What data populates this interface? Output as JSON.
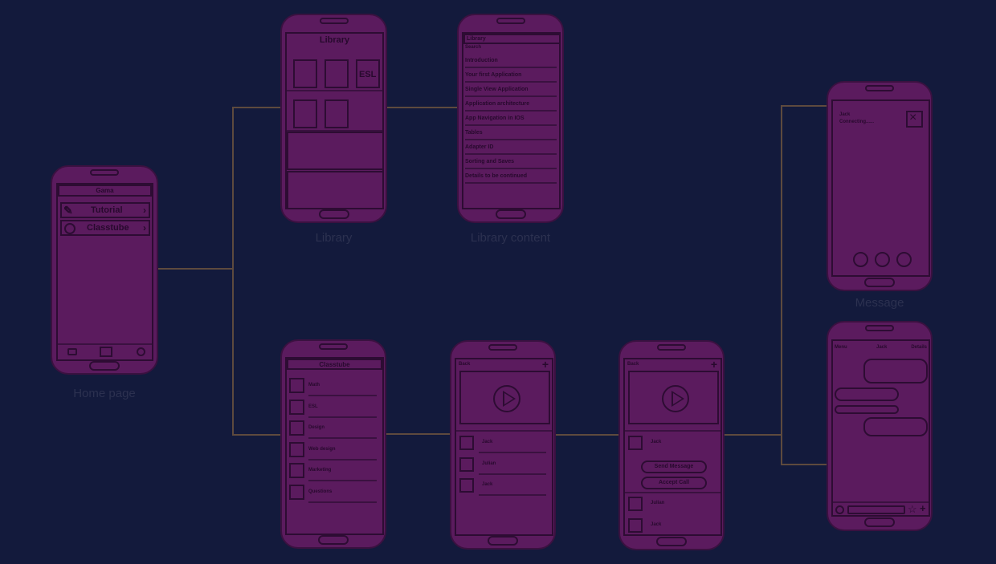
{
  "labels": {
    "home": "Home page",
    "library": "Library",
    "library_content": "Library content",
    "message": "Message"
  },
  "home": {
    "header": "Gama",
    "items": [
      "Tutorial",
      "Classtube"
    ]
  },
  "library": {
    "title": "Library",
    "tiles": [
      "",
      "",
      "ESL",
      "",
      ""
    ]
  },
  "library_content": {
    "header": "Library",
    "sub": "Search",
    "items": [
      "Introduction",
      "Your first Application",
      "Single View Application",
      "Application architecture",
      "App Navigation in IOS",
      "Tables",
      "Adapter ID",
      "Sorting and Saves",
      "Details to be continued"
    ]
  },
  "classtube": {
    "header": "Classtube",
    "items": [
      "Math",
      "ESL",
      "Design",
      "Web design",
      "Marketing",
      "Questions"
    ]
  },
  "video1": {
    "back": "Back",
    "people": [
      "Jack",
      "Julian",
      "Jack"
    ]
  },
  "video2": {
    "back": "Back",
    "person": "Jack",
    "buttons": [
      "Send Message",
      "Accept Call"
    ],
    "people": [
      "Julian",
      "Jack"
    ]
  },
  "message": {
    "caller": "Jack",
    "status": "Connecting......"
  },
  "chat": {
    "left": "Menu",
    "center": "Jack",
    "right": "Details"
  },
  "colors": {
    "background": "#131a3c",
    "phone": "#5b1b5e",
    "outline": "#2d0c33",
    "connector": "#5e4a3e",
    "caption": "#2c3150"
  }
}
